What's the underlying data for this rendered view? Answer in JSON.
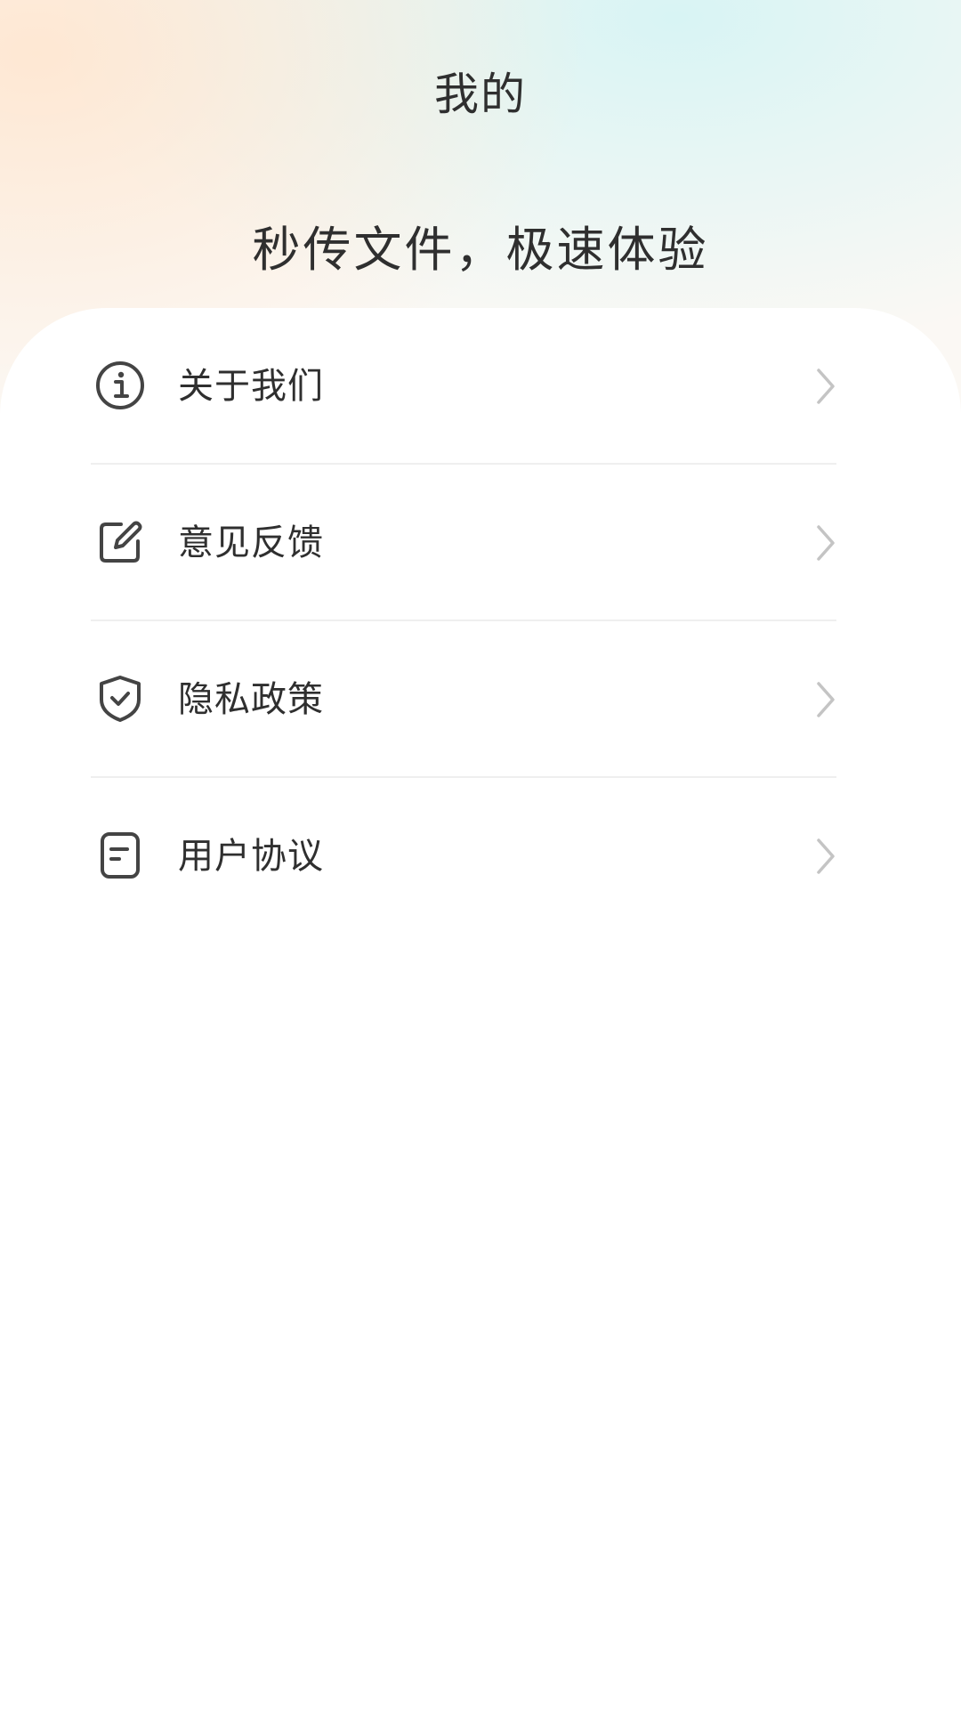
{
  "header": {
    "title": "我的",
    "slogan": "秒传文件，极速体验"
  },
  "menu": {
    "items": [
      {
        "label": "关于我们",
        "icon": "info-icon"
      },
      {
        "label": "意见反馈",
        "icon": "edit-icon"
      },
      {
        "label": "隐私政策",
        "icon": "shield-check-icon"
      },
      {
        "label": "用户协议",
        "icon": "document-icon"
      }
    ]
  },
  "colors": {
    "text": "#2f2f2f",
    "icon": "#444444",
    "chevron": "#c4c4c4",
    "divider": "#efefef"
  }
}
